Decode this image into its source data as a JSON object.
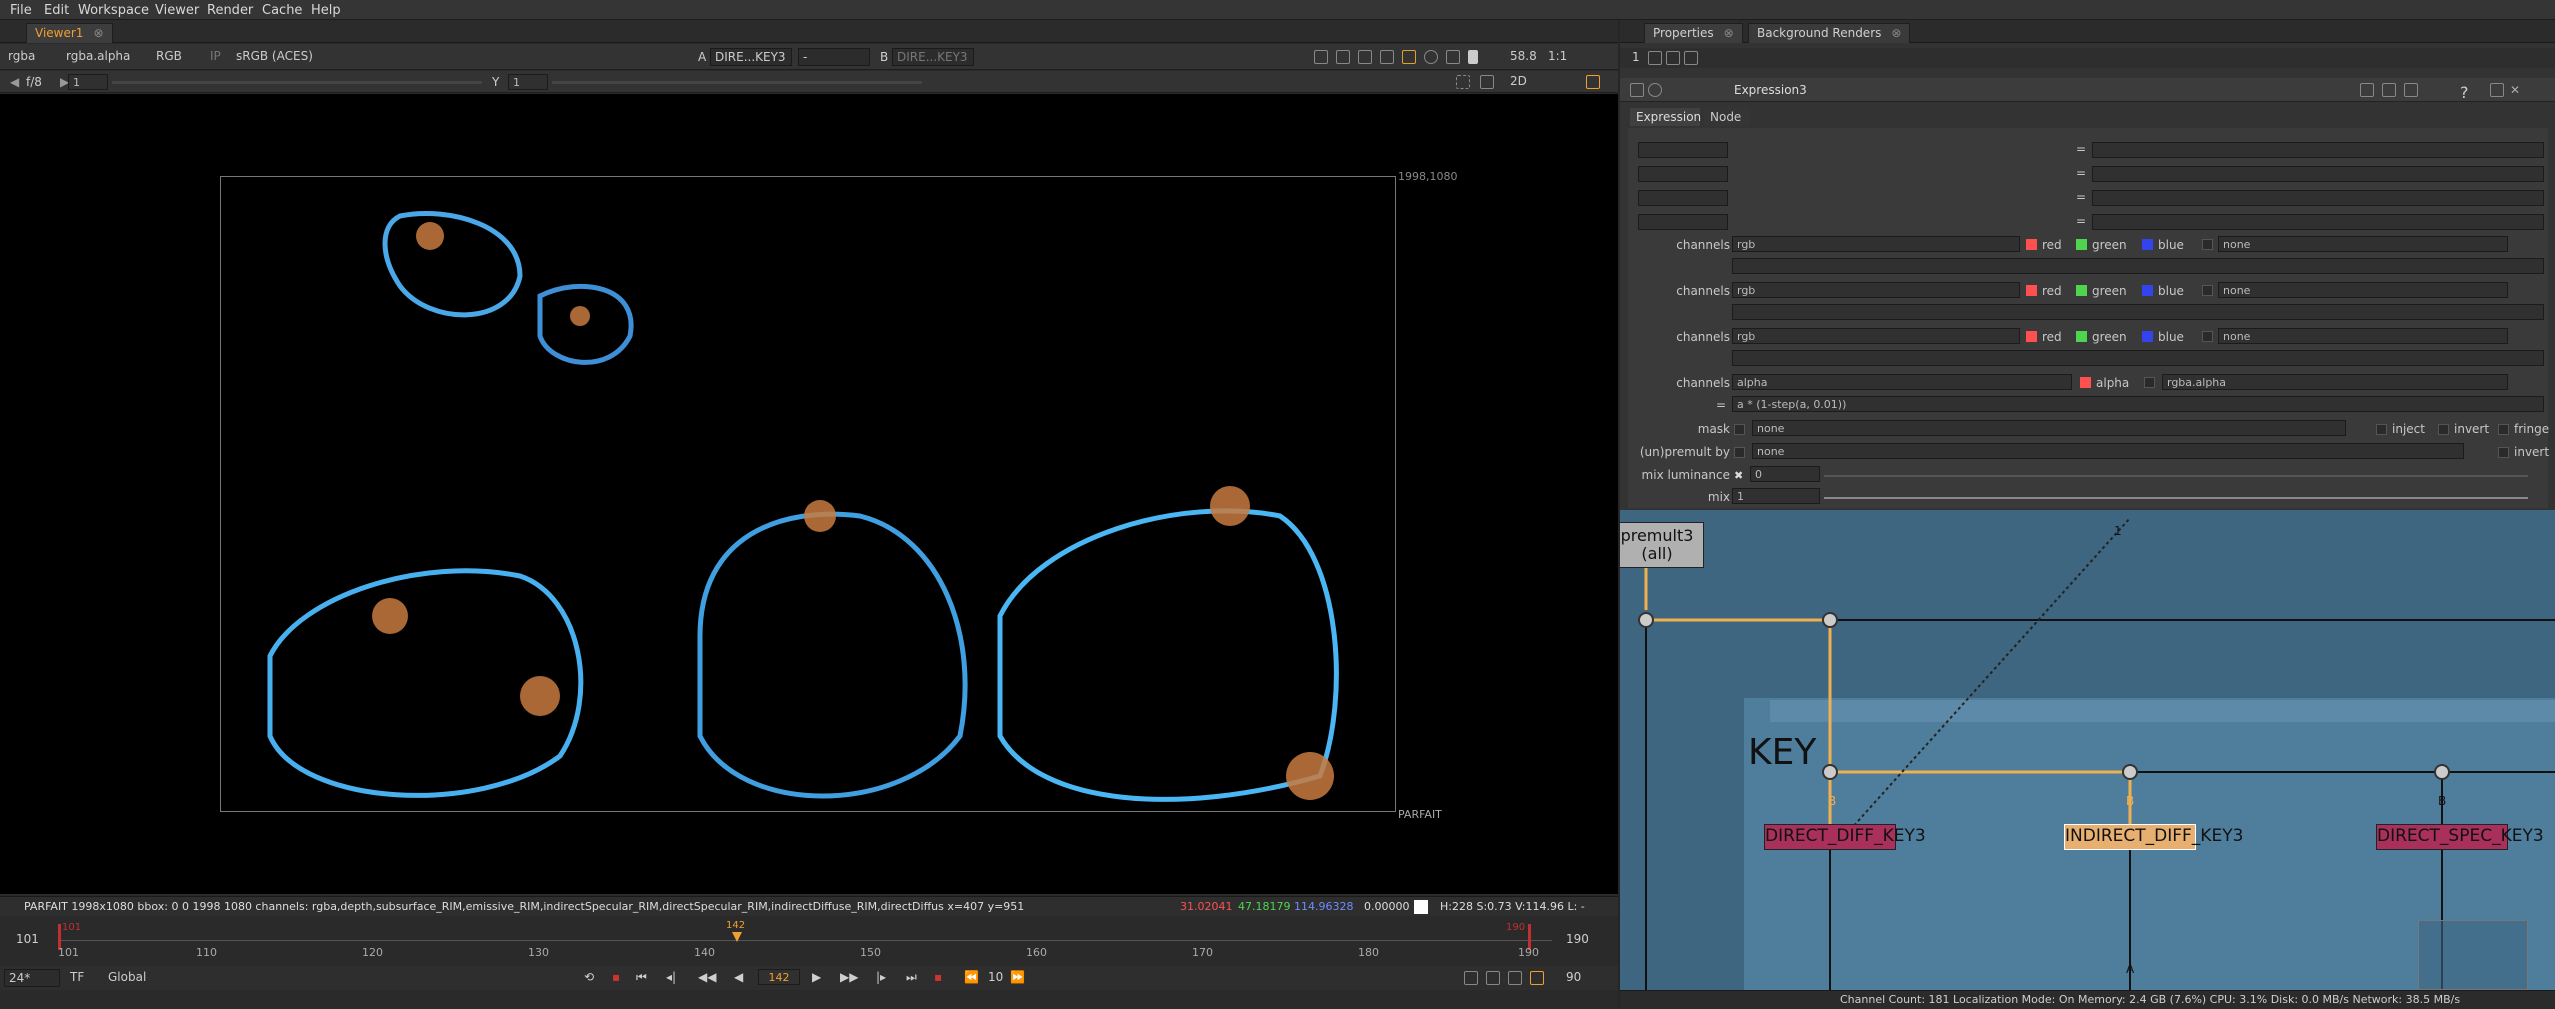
{
  "menubar": [
    "File",
    "Edit",
    "Workspace",
    "Viewer",
    "Render",
    "Cache",
    "Help"
  ],
  "viewer": {
    "tab": "Viewer1",
    "layer": "rgba",
    "channel": "rgba.alpha",
    "display": "RGB",
    "ip": "IP",
    "colorspace": "sRGB (ACES)",
    "input_a_label": "A",
    "input_a": "DIRE...KEY3",
    "wipe": "-",
    "input_b_label": "B",
    "input_b": "DIRE...KEY3",
    "gain": "f/8",
    "gain_value": "1",
    "gamma_label": "Y",
    "gamma_value": "1",
    "zoom": "58.8",
    "ratio": "1:1",
    "mode": "2D",
    "format_label": "1998,1080",
    "format_name": "PARFAIT",
    "status_info": "PARFAIT 1998x1080  bbox: 0 0 1998 1080 channels: rgba,depth,subsurface_RIM,emissive_RIM,indirectSpecular_RIM,directSpecular_RIM,indirectDiffuse_RIM,directDiffus  x=407 y=951",
    "pixel_r": "31.02041",
    "pixel_g": "47.18179",
    "pixel_b": "114.96328",
    "pixel_a": "0.00000",
    "hsv": "H:228 S:0.73 V:114.96  L: -",
    "colors": {
      "red": "#ff5050",
      "green": "#4ed44e",
      "blue": "#6e8cff"
    }
  },
  "timeline": {
    "in_frame": "101",
    "out_frame": "190",
    "in_marker": "101",
    "out_marker": "190",
    "current": "142",
    "ticks": [
      "101",
      "110",
      "120",
      "130",
      "140",
      "150",
      "160",
      "170",
      "180",
      "190"
    ],
    "fps": "24*",
    "tf": "TF",
    "scope": "Global",
    "frame_display": "142",
    "step": "10",
    "end_display": "90"
  },
  "properties": {
    "tabs": [
      "Properties",
      "Background Renders"
    ],
    "node_name": "Expression3",
    "subtabs": [
      "Expression",
      "Node"
    ],
    "eq": "=",
    "channels_label": "channels",
    "rows": [
      {
        "sel": "rgb",
        "c1": "red",
        "c2": "green",
        "c3": "blue",
        "extra": "none"
      },
      {
        "sel": "rgb",
        "c1": "red",
        "c2": "green",
        "c3": "blue",
        "extra": "none"
      },
      {
        "sel": "rgb",
        "c1": "red",
        "c2": "green",
        "c3": "blue",
        "extra": "none"
      }
    ],
    "alpha_row": {
      "sel": "alpha",
      "c1": "alpha",
      "extra": "rgba.alpha"
    },
    "expression": "a * (1-step(a, 0.01))",
    "mask_label": "mask",
    "mask_value": "none",
    "inject": "inject",
    "invert": "invert",
    "fringe": "fringe",
    "unpremult_label": "(un)premult by",
    "unpremult_value": "none",
    "mix_lum_label": "mix luminance",
    "mix_lum_value": "0",
    "mix_label": "mix",
    "mix_value": "1",
    "slider_ticks": [
      "0.1",
      "0.2",
      "0.3",
      "0.4",
      "0.5",
      "0.6",
      "0.7",
      "0.8",
      "0.9"
    ]
  },
  "nodegraph": {
    "premult_node": "premult3",
    "premult_sub": "(all)",
    "backdrop_label": "KEY",
    "node1": "DIRECT_DIFF_KEY3",
    "node2": "INDIRECT_DIFF_KEY3",
    "node3": "DIRECT_SPEC_KEY3",
    "pipe_b": "B",
    "pipe_a": "A",
    "pipe_1": "1"
  },
  "statusbar": "Channel Count: 181  Localization Mode: On  Memory: 2.4 GB (7.6%)  CPU: 3.1%  Disk: 0.0 MB/s  Network: 38.5 MB/s"
}
